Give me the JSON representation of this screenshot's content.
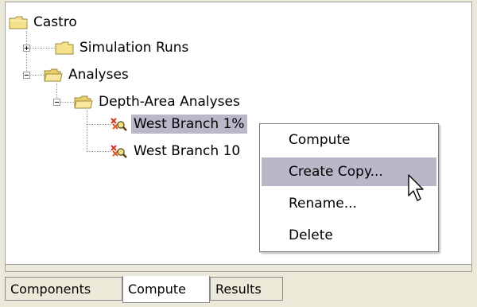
{
  "tree": {
    "root": {
      "label": "Castro"
    },
    "simulation_runs": {
      "label": "Simulation Runs",
      "expander": "plus"
    },
    "analyses": {
      "label": "Analyses",
      "expander": "minus"
    },
    "depth_area": {
      "label": "Depth-Area Analyses",
      "expander": "minus"
    },
    "items": [
      {
        "label": "West Branch 1%",
        "selected": true,
        "icon": "analysis-icon"
      },
      {
        "label": "West Branch 10",
        "selected": false,
        "icon": "analysis-icon"
      }
    ]
  },
  "context_menu": {
    "items": [
      {
        "label": "Compute",
        "hover": false
      },
      {
        "label": "Create Copy...",
        "hover": true
      },
      {
        "label": "Rename...",
        "hover": false
      },
      {
        "label": "Delete",
        "hover": false
      }
    ]
  },
  "tabs": [
    {
      "label": "Components",
      "active": false
    },
    {
      "label": "Compute",
      "active": true
    },
    {
      "label": "Results",
      "active": false
    }
  ],
  "colors": {
    "selection": "#b8b8c8",
    "folder": "#f5e08c"
  },
  "icons": {
    "folder": "folder-icon",
    "analysis": "analysis-icon",
    "cursor": "mouse-pointer-icon"
  }
}
